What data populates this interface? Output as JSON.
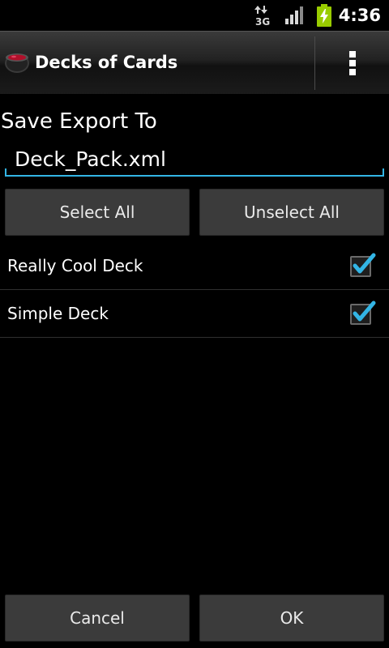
{
  "status_bar": {
    "network_type": "3G",
    "time": "4:36",
    "icons": [
      "data-3g-icon",
      "signal-strength-icon",
      "battery-charging-icon"
    ]
  },
  "action_bar": {
    "title": "Decks of Cards",
    "icon": "app-cauldron-icon",
    "overflow_icon": "overflow-menu-icon"
  },
  "export": {
    "label": "Save Export To",
    "filename": "Deck_Pack.xml"
  },
  "buttons": {
    "select_all": "Select All",
    "unselect_all": "Unselect All",
    "cancel": "Cancel",
    "ok": "OK"
  },
  "decks": [
    {
      "name": "Really Cool Deck",
      "checked": true
    },
    {
      "name": "Simple Deck",
      "checked": true
    }
  ],
  "colors": {
    "accent": "#33b5e5",
    "background": "#000000",
    "button": "#3b3b3b"
  }
}
